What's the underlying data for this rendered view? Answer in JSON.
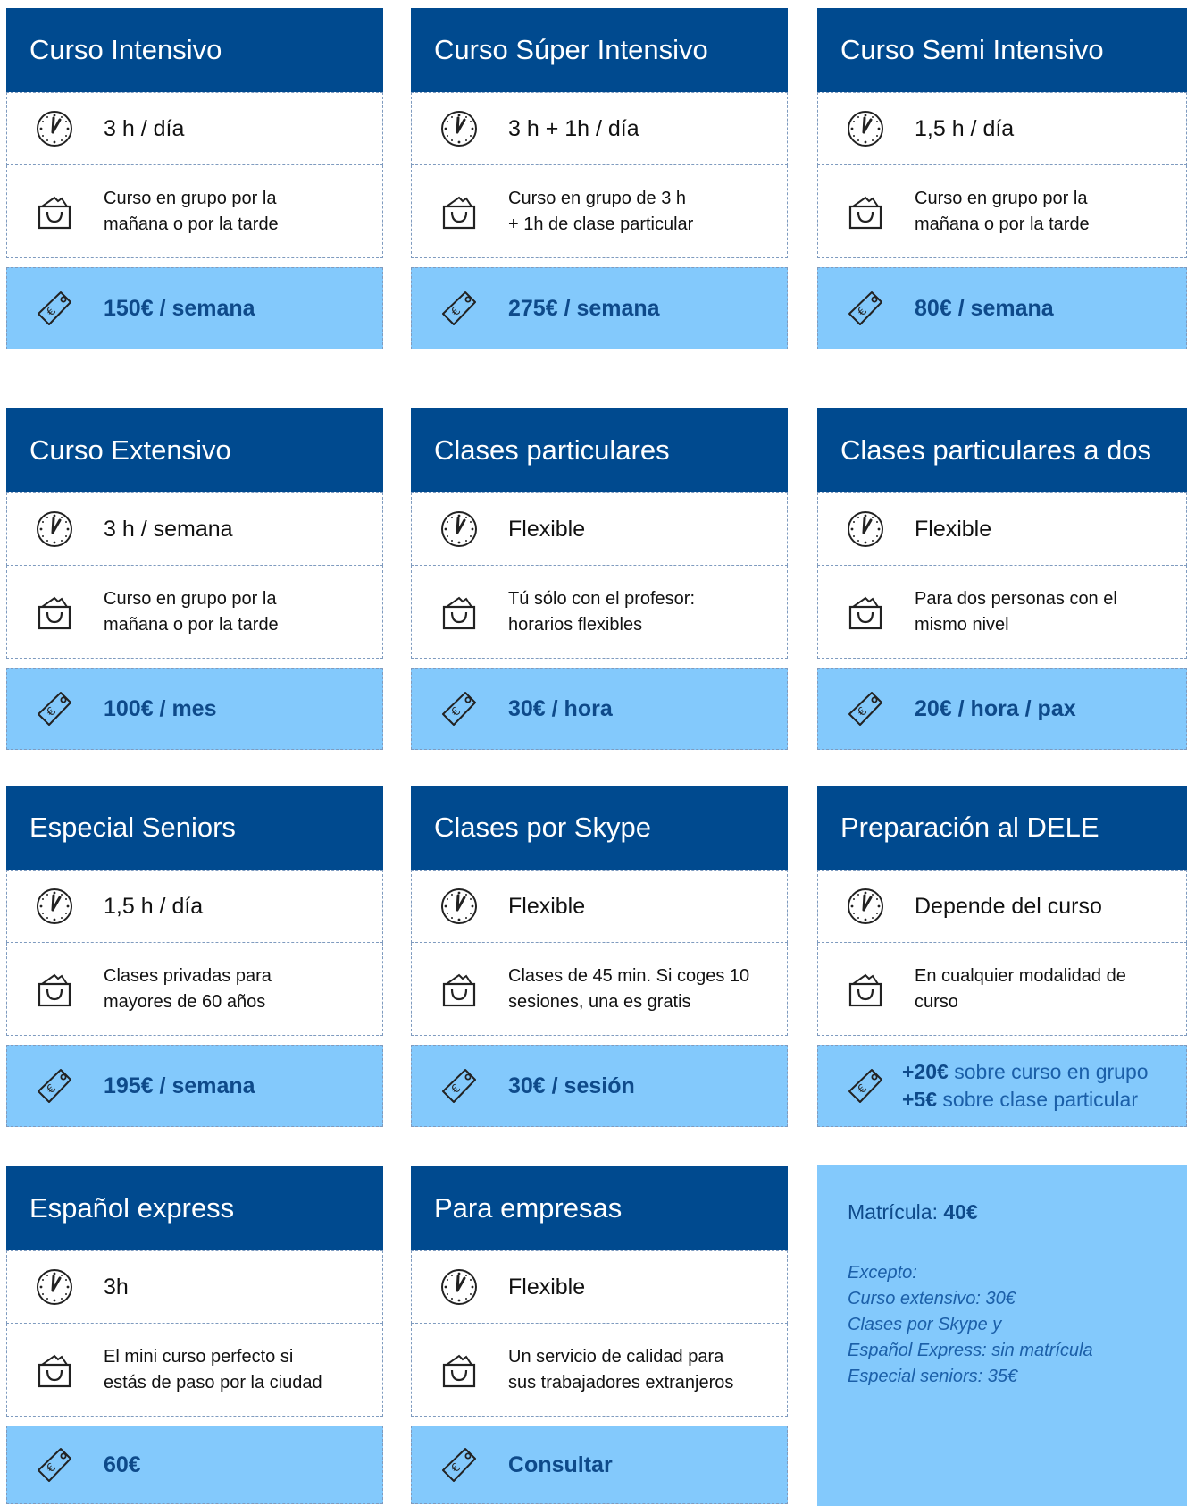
{
  "cards": [
    {
      "title": "Curso Intensivo",
      "time": "3 h / día",
      "desc": "Curso en grupo por la\nmañana o por la tarde",
      "price": "150€ / semana"
    },
    {
      "title": "Curso Súper Intensivo",
      "time": "3 h + 1h / día",
      "desc": "Curso en grupo de 3 h\n+ 1h de clase particular",
      "price": "275€ / semana"
    },
    {
      "title": "Curso Semi Intensivo",
      "time": "1,5 h / día",
      "desc": "Curso en grupo por la\nmañana o por la tarde",
      "price": "80€ / semana"
    },
    {
      "title": "Curso Extensivo",
      "time": "3 h / semana",
      "desc": "Curso en grupo por la\nmañana o por la tarde",
      "price": "100€ / mes"
    },
    {
      "title": "Clases particulares",
      "time": "Flexible",
      "desc": "Tú sólo con el profesor:\nhorarios flexibles",
      "price": "30€ / hora"
    },
    {
      "title": "Clases particulares a dos",
      "time": "Flexible",
      "desc": "Para dos personas con el\nmismo nivel",
      "price": "20€ / hora / pax"
    },
    {
      "title": "Especial Seniors",
      "time": "1,5 h / día",
      "desc": "Clases privadas para\nmayores de 60 años",
      "price": "195€ / semana"
    },
    {
      "title": "Clases por Skype",
      "time": "Flexible",
      "desc": "Clases de 45 min. Si coges 10\nsesiones, una es gratis",
      "price": "30€ / sesión"
    },
    {
      "title": "Preparación al DELE",
      "time": "Depende del curso",
      "desc": "En cualquier modalidad de\ncurso",
      "price_line1_bold": "+20€",
      "price_line1_rest": " sobre curso en grupo",
      "price_line2_bold": "+5€",
      "price_line2_rest": " sobre clase particular"
    },
    {
      "title": "Español express",
      "time": "3h",
      "desc": "El mini curso perfecto si\nestás de paso por la ciudad",
      "price": "60€"
    },
    {
      "title": "Para empresas",
      "time": "Flexible",
      "desc": "Un servicio de calidad para\nsus trabajadores extranjeros",
      "price": "Consultar"
    }
  ],
  "info": {
    "matricula_label": "Matrícula: ",
    "matricula_value": "40€",
    "exceptions": [
      "Excepto:",
      "Curso extensivo: 30€",
      "Clases por Skype y",
      "Español Express: sin matrícula",
      "Especial seniors: 35€"
    ]
  },
  "icons": {
    "time": "clock-icon",
    "desc": "bag-icon",
    "price": "price-tag-icon"
  },
  "colors": {
    "header": "#004a8f",
    "price_bg": "#83c9fc",
    "price_text": "#0e4a8a",
    "border": "#7f9bbf"
  }
}
